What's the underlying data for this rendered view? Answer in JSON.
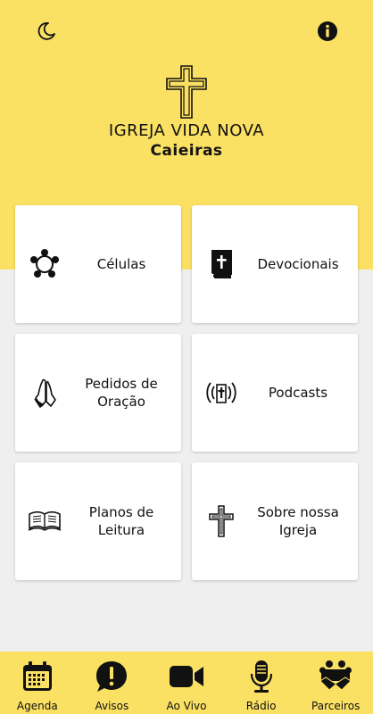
{
  "header": {
    "theme_toggle_icon": "moon-icon",
    "info_icon": "info-icon",
    "church_name": "IGREJA VIDA NOVA",
    "church_city": "Caieiras",
    "accent_color": "#fae063"
  },
  "menu": {
    "cards": [
      {
        "label": "Células",
        "icon": "group-icon"
      },
      {
        "label": "Devocionais",
        "icon": "bible-icon"
      },
      {
        "label": "Pedidos de\nOração",
        "icon": "praying-hands-icon"
      },
      {
        "label": "Podcasts",
        "icon": "podcast-icon"
      },
      {
        "label": "Planos de\nLeitura",
        "icon": "open-book-icon"
      },
      {
        "label": "Sobre nossa\nIgreja",
        "icon": "cross-icon"
      }
    ]
  },
  "bottom_nav": {
    "items": [
      {
        "label": "Agenda",
        "icon": "calendar-icon"
      },
      {
        "label": "Avisos",
        "icon": "alert-icon"
      },
      {
        "label": "Ao Vivo",
        "icon": "video-icon"
      },
      {
        "label": "Rádio",
        "icon": "microphone-icon"
      },
      {
        "label": "Parceiros",
        "icon": "partners-icon"
      }
    ]
  }
}
